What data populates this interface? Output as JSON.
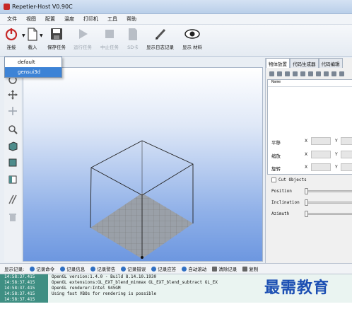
{
  "window": {
    "title": "Repetier-Host V0.90C"
  },
  "menu": [
    "文件",
    "视图",
    "配置",
    "温度",
    "打印机",
    "工具",
    "帮助"
  ],
  "toolbar": {
    "connect": "连接",
    "load": "载入",
    "save_job": "保存任务",
    "run_job": "运行任务",
    "stop_job": "中止任务",
    "sd_card": "SD卡",
    "show_log": "显示日志记录",
    "show_material": "显示 材料"
  },
  "profile_dropdown": {
    "options": [
      "default",
      "gensui3d"
    ],
    "selected": "gensui3d"
  },
  "right_panel": {
    "tabs": [
      "物体放置",
      "代码生成器",
      "代码编辑"
    ],
    "list_header": "Name",
    "translate": "平移",
    "scale": "缩放",
    "rotate": "旋转",
    "axis_x": "X",
    "axis_y": "Y",
    "cut_objects": "Cut Objects",
    "position": "Position",
    "inclination": "Inclination",
    "azimuth": "Azimuth"
  },
  "log_toolbar": {
    "label": "显示记录:",
    "items": [
      "记录命令",
      "记录信息",
      "记录警告",
      "记录错误",
      "记录应答",
      "自动滚动",
      "清除记录",
      "复制"
    ]
  },
  "log": [
    {
      "time": "14:58:37.415",
      "msg": "OpenGL version:1.4.0 - Build 8.14.10.1930"
    },
    {
      "time": "14:58:37.415",
      "msg": "OpenGL extensions:GL_EXT_blend_minmax GL_EXT_blend_subtract GL_EX"
    },
    {
      "time": "14:58:37.415",
      "msg": "OpenGL renderer:Intel 945GM"
    },
    {
      "time": "14:58:37.415",
      "msg": "Using fast VBOs for rendering is possible"
    },
    {
      "time": "14:58:37.415",
      "msg": ""
    }
  ],
  "watermark": "最需教育",
  "colors": {
    "accent": "#3d83d6",
    "log_time": "#3f8f83",
    "power": "#c62828"
  }
}
